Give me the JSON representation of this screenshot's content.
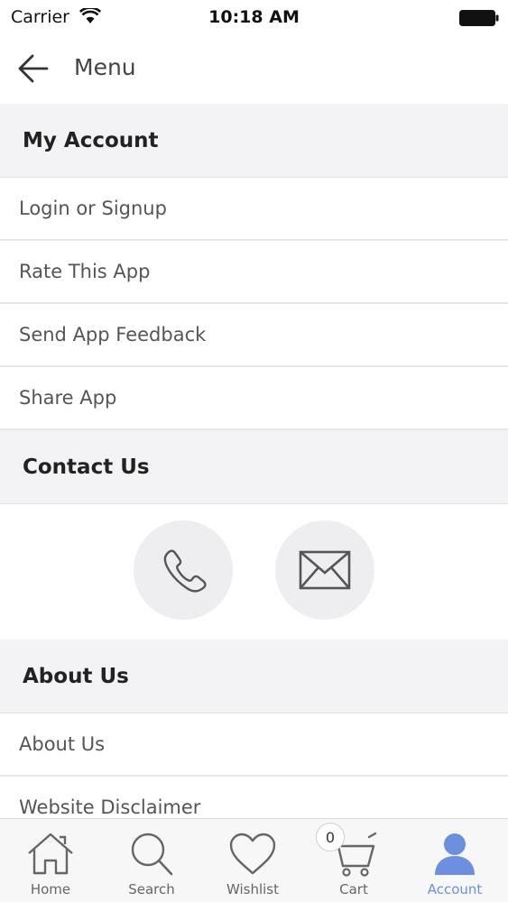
{
  "status_bar": {
    "carrier": "Carrier",
    "time": "10:18 AM"
  },
  "nav": {
    "title": "Menu",
    "back_icon": "arrow-left-icon"
  },
  "sections": {
    "my_account": {
      "title": "My Account",
      "items": [
        "Login or Signup",
        "Rate This App",
        "Send App Feedback",
        "Share App"
      ]
    },
    "contact_us": {
      "title": "Contact Us",
      "icons": [
        "phone-icon",
        "mail-icon"
      ]
    },
    "about_us": {
      "title": "About Us",
      "items": [
        "About Us",
        "Website Disclaimer"
      ]
    }
  },
  "tab_bar": {
    "tabs": [
      {
        "label": "Home",
        "icon": "home-icon"
      },
      {
        "label": "Search",
        "icon": "search-icon"
      },
      {
        "label": "Wishlist",
        "icon": "heart-icon"
      },
      {
        "label": "Cart",
        "icon": "cart-icon"
      },
      {
        "label": "Account",
        "icon": "user-icon"
      }
    ],
    "active": "Account",
    "cart_count": "0"
  },
  "colors": {
    "accent": "#6d8fe0",
    "section_bg": "#f3f2f4"
  }
}
